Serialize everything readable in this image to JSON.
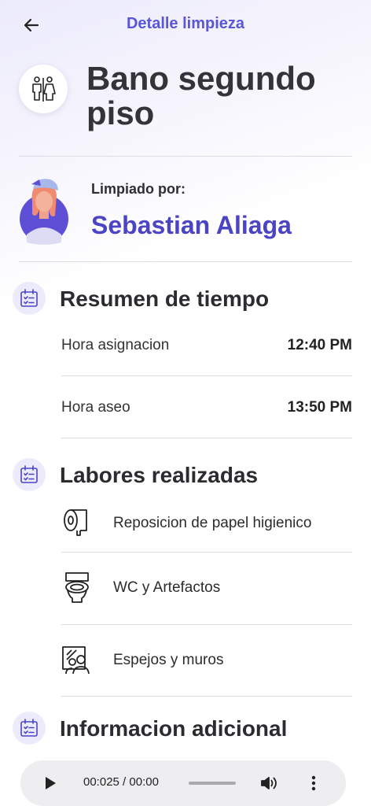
{
  "header": {
    "title": "Detalle limpieza",
    "back_icon": "arrow-left-icon"
  },
  "room": {
    "name": "Bano segundo piso",
    "icon": "restroom-icon"
  },
  "cleaner": {
    "label": "Limpiado por:",
    "name": "Sebastian Aliaga"
  },
  "time_summary": {
    "title": "Resumen de tiempo",
    "icon": "calendar-checklist-icon",
    "rows": [
      {
        "label": "Hora asignacion",
        "value": "12:40 PM"
      },
      {
        "label": "Hora aseo",
        "value": "13:50 PM"
      }
    ]
  },
  "tasks": {
    "title": "Labores realizadas",
    "icon": "calendar-checklist-icon",
    "items": [
      {
        "label": "Reposicion de papel higienico",
        "icon": "toilet-paper-icon"
      },
      {
        "label": "WC y Artefactos",
        "icon": "toilet-icon"
      },
      {
        "label": "Espejos y muros",
        "icon": "mirror-person-icon"
      }
    ]
  },
  "additional": {
    "title": "Informacion adicional",
    "icon": "calendar-checklist-icon"
  },
  "audio": {
    "time": "00:025 / 00:00",
    "progress": 0.0,
    "play_icon": "play-icon",
    "volume_icon": "volume-icon",
    "more_icon": "more-vertical-icon"
  },
  "colors": {
    "accent": "#5a57d6",
    "name": "#4b44c4",
    "section_icon_bg": "#ecebfb"
  }
}
